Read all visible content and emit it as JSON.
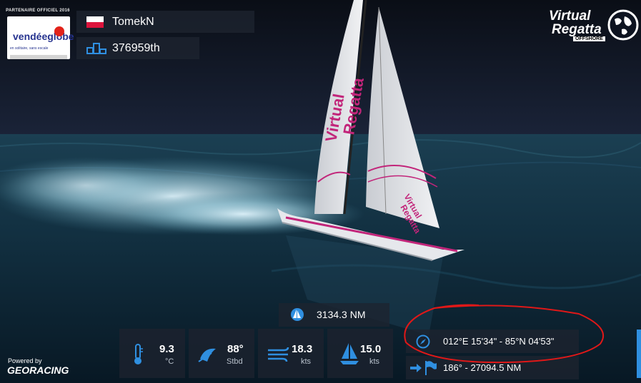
{
  "sponsor": {
    "header": "PARTENAIRE OFFICIEL 2016",
    "logo_text": "vendéeglobe",
    "logo_subtext": "en solitaire, sans escale"
  },
  "player": {
    "name": "TomekN",
    "rank": "376959th",
    "flag": "poland-flag"
  },
  "brand": {
    "line1": "Virtual",
    "line2": "Regatta",
    "line3": "OFFSHORE"
  },
  "boat_sail_text": "Virtual Regatta",
  "distance": "3134.3 NM",
  "stats": {
    "temperature": {
      "value": "9.3",
      "unit": "°C"
    },
    "wind_angle": {
      "value": "88°",
      "unit": "Stbd"
    },
    "wind_speed": {
      "value": "18.3",
      "unit": "kts"
    },
    "boat_speed": {
      "value": "15.0",
      "unit": "kts"
    }
  },
  "position": "012°E 15'34\" - 85°N 04'53\"",
  "heading": "186° - 27094.5 NM",
  "footer": {
    "powered_by": "Powered by",
    "georacing": "GEORACING"
  },
  "colors": {
    "accent_blue": "#2f8fe0",
    "annotation_red": "#e01818",
    "sail_magenta": "#c2257a"
  }
}
